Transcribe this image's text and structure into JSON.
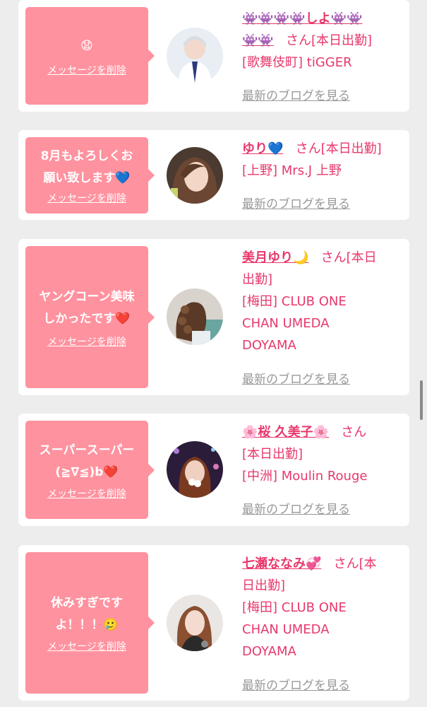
{
  "cards": [
    {
      "message": "😧",
      "delete_label": "メッセージを削除",
      "name": "👾👾👾👾しよ👾👾\n👾👾",
      "name_line1": "👾👾👾👾しよ👾👾",
      "name_line2": "👾👾",
      "san": "さん[本日出勤]",
      "shop": "[歌舞伎町] tiGGER",
      "blog_label": "最新のブログを見る"
    },
    {
      "message": "8月もよろしくお\n願い致します💙",
      "delete_label": "メッセージを削除",
      "name": "ゆり💙",
      "san_line1": "さん[本日出勤]",
      "shop": "[上野] Mrs.J 上野",
      "blog_label": "最新のブログを見る"
    },
    {
      "message": "ヤングコーン美味\nしかったです❤️",
      "delete_label": "メッセージを削除",
      "name": "美月ゆり🌙",
      "san_line1": "さん[本日",
      "san_line2": "出勤]",
      "shop_line1": "[梅田] CLUB ONE",
      "shop_line2": "CHAN UMEDA",
      "shop_line3": "DOYAMA",
      "blog_label": "最新のブログを見る"
    },
    {
      "message": "スーパースーパー\n(≧∇≦)b❤️",
      "delete_label": "メッセージを削除",
      "name": "🌸桜 久美子🌸",
      "san_line1": "さん",
      "san_line2": "[本日出勤]",
      "shop": "[中洲] Moulin Rouge",
      "blog_label": "最新のブログを見る"
    },
    {
      "message": "休みすぎです\nよ！！！🥲",
      "delete_label": "メッセージを削除",
      "name": "七瀬ななみ💞",
      "san_line1": "さん[本",
      "san_line2": "日出勤]",
      "shop_line1": "[梅田] CLUB ONE",
      "shop_line2": "CHAN UMEDA",
      "shop_line3": "DOYAMA",
      "blog_label": "最新のブログを見る"
    }
  ],
  "colors": {
    "page_bg": "#ededed",
    "bubble": "#ff929f",
    "accent_text": "#e8386b",
    "link_gray": "#999999"
  }
}
